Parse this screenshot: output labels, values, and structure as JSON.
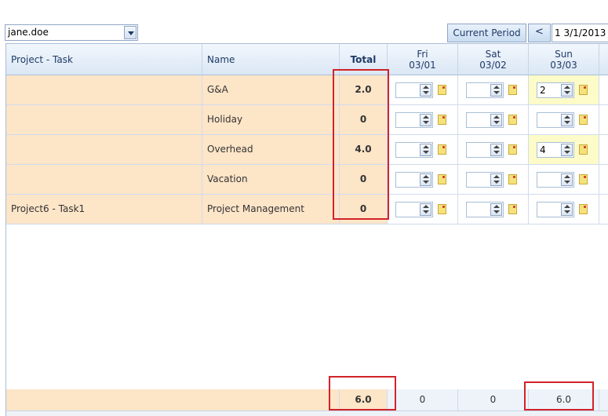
{
  "user_select": {
    "value": "jane.doe"
  },
  "period": {
    "current_label": "Current Period",
    "prev_label": "<",
    "range_text": "1 3/1/2013 -"
  },
  "columns": {
    "project_task": "Project - Task",
    "name": "Name",
    "total": "Total",
    "days": [
      {
        "day": "Fri",
        "date": "03/01"
      },
      {
        "day": "Sat",
        "date": "03/02"
      },
      {
        "day": "Sun",
        "date": "03/03"
      }
    ]
  },
  "rows": [
    {
      "project_task": "",
      "name": "G&A",
      "total": "2.0",
      "entries": [
        "",
        "",
        "2"
      ]
    },
    {
      "project_task": "",
      "name": "Holiday",
      "total": "0",
      "entries": [
        "",
        "",
        ""
      ]
    },
    {
      "project_task": "",
      "name": "Overhead",
      "total": "4.0",
      "entries": [
        "",
        "",
        "4"
      ]
    },
    {
      "project_task": "",
      "name": "Vacation",
      "total": "0",
      "entries": [
        "",
        "",
        ""
      ]
    },
    {
      "project_task": "Project6 - Task1",
      "name": "Project Management",
      "total": "0",
      "entries": [
        "",
        "",
        ""
      ]
    }
  ],
  "footer": {
    "total": "6.0",
    "days": [
      "0",
      "0",
      "6.0"
    ]
  },
  "colors": {
    "row_highlight": "#fde5c8",
    "annotation": "#d2232a",
    "entry_highlight": "#fdfbc8",
    "header_text": "#1f3a66"
  },
  "icons": [
    "chevron-down-icon",
    "spinner-arrows-icon",
    "note-icon"
  ]
}
